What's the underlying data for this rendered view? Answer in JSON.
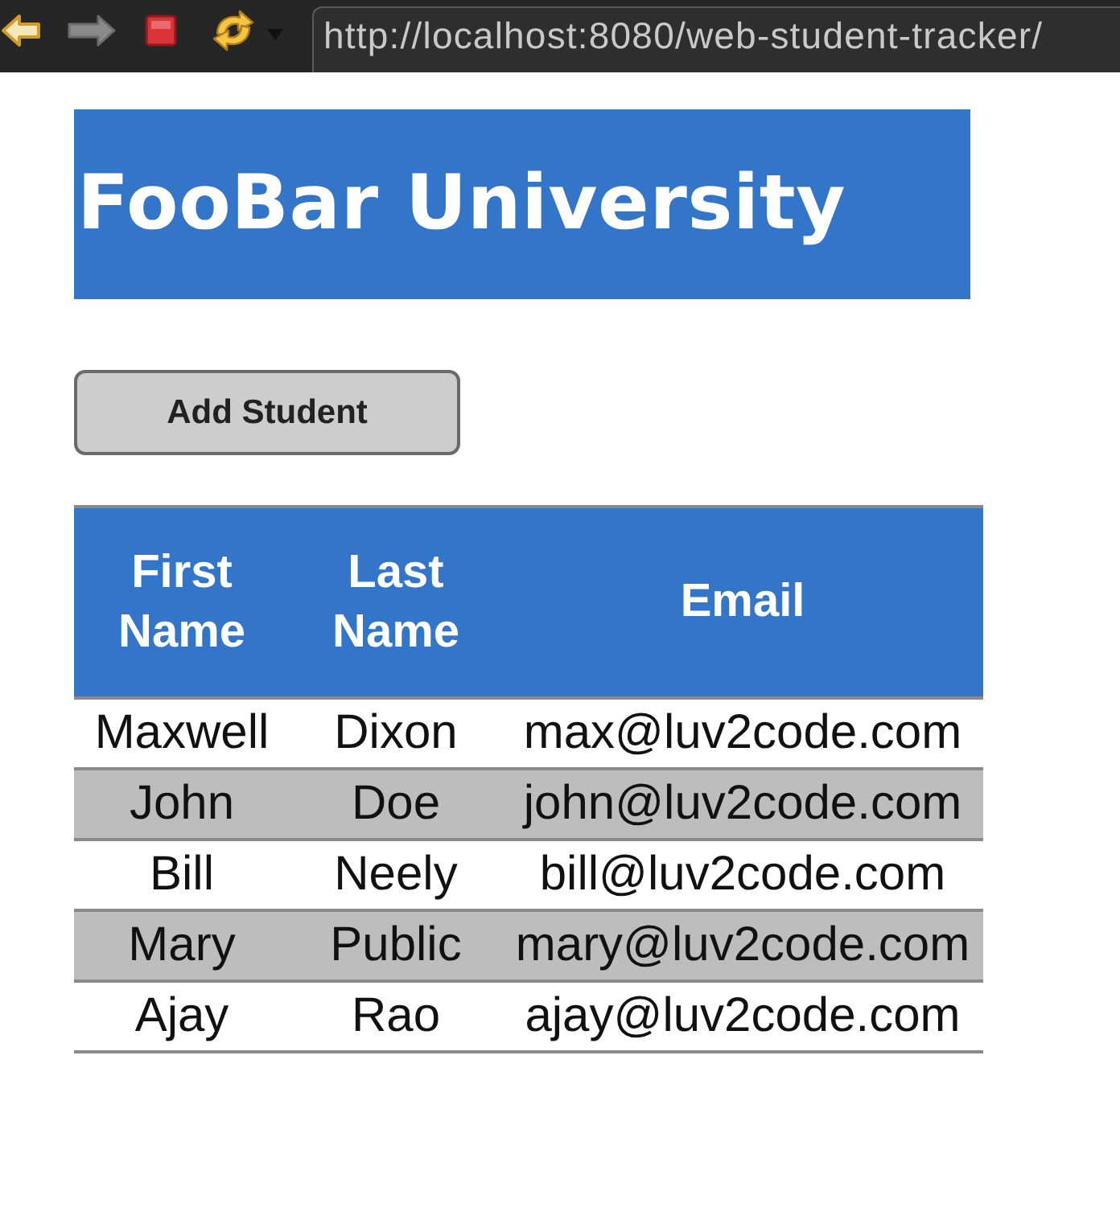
{
  "browser": {
    "url": "http://localhost:8080/web-student-tracker/"
  },
  "header": {
    "title": "FooBar University"
  },
  "add_button": {
    "label": "Add Student"
  },
  "table": {
    "columns": [
      "First Name",
      "Last Name",
      "Email"
    ],
    "rows": [
      [
        "Maxwell",
        "Dixon",
        "max@luv2code.com"
      ],
      [
        "John",
        "Doe",
        "john@luv2code.com"
      ],
      [
        "Bill",
        "Neely",
        "bill@luv2code.com"
      ],
      [
        "Mary",
        "Public",
        "mary@luv2code.com"
      ],
      [
        "Ajay",
        "Rao",
        "ajay@luv2code.com"
      ]
    ]
  }
}
